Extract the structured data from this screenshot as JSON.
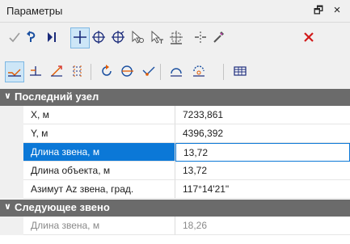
{
  "window": {
    "title": "Параметры",
    "float_glyph": "🗗",
    "close_glyph": "×"
  },
  "toolbar1": {
    "tools": [
      {
        "icon": "checkmark-icon",
        "active": false
      },
      {
        "icon": "undo-arrow-icon",
        "active": false
      },
      {
        "icon": "cursor-i-icon",
        "active": false
      },
      {
        "icon": "crosshair-icon",
        "active": true
      },
      {
        "icon": "circle-cross-icon",
        "active": false
      },
      {
        "icon": "circle-cross-arrow-icon",
        "active": false
      },
      {
        "icon": "pointer-snap-icon",
        "active": false
      },
      {
        "icon": "pointer-t-icon",
        "active": false
      },
      {
        "icon": "target-line-icon",
        "active": false
      },
      {
        "icon": "split-icon",
        "active": false
      },
      {
        "icon": "eyedropper-icon",
        "active": false
      },
      {
        "icon": "delete-x-icon",
        "active": false
      }
    ]
  },
  "toolbar2": {
    "tools": [
      {
        "icon": "snap-line-icon",
        "active": true
      },
      {
        "icon": "snap-perpendicular-icon",
        "active": false
      },
      {
        "icon": "snap-arrow-icon",
        "active": false
      },
      {
        "icon": "snap-grid-icon",
        "active": false
      },
      {
        "icon": "arc-rotate-icon",
        "active": false
      },
      {
        "icon": "arc-circle-icon",
        "active": false
      },
      {
        "icon": "snap-vertex-icon",
        "active": false
      },
      {
        "icon": "arc-measure-icon",
        "active": false
      },
      {
        "icon": "arc-center-icon",
        "active": false
      },
      {
        "icon": "table-icon",
        "active": false
      }
    ]
  },
  "colors": {
    "group_header": "#6b6b6b",
    "selection": "#0b78d7",
    "delete_red": "#d11a1a",
    "snap_orange": "#e05a00"
  },
  "grid": {
    "groups": [
      {
        "title": "Последний узел",
        "rows": [
          {
            "name": "X, м",
            "value": "7233,861",
            "selected": false,
            "disabled": false
          },
          {
            "name": "Y, м",
            "value": "4396,392",
            "selected": false,
            "disabled": false
          },
          {
            "name": "Длина звена, м",
            "value": "13,72",
            "selected": true,
            "disabled": false
          },
          {
            "name": "Длина объекта, м",
            "value": "13,72",
            "selected": false,
            "disabled": false
          },
          {
            "name": "Азимут Az звена, град.",
            "value": " 117°14'21\"",
            "selected": false,
            "disabled": false
          }
        ]
      },
      {
        "title": "Следующее звено",
        "rows": [
          {
            "name": "Длина звена, м",
            "value": "18,26",
            "selected": false,
            "disabled": true
          }
        ]
      }
    ]
  }
}
